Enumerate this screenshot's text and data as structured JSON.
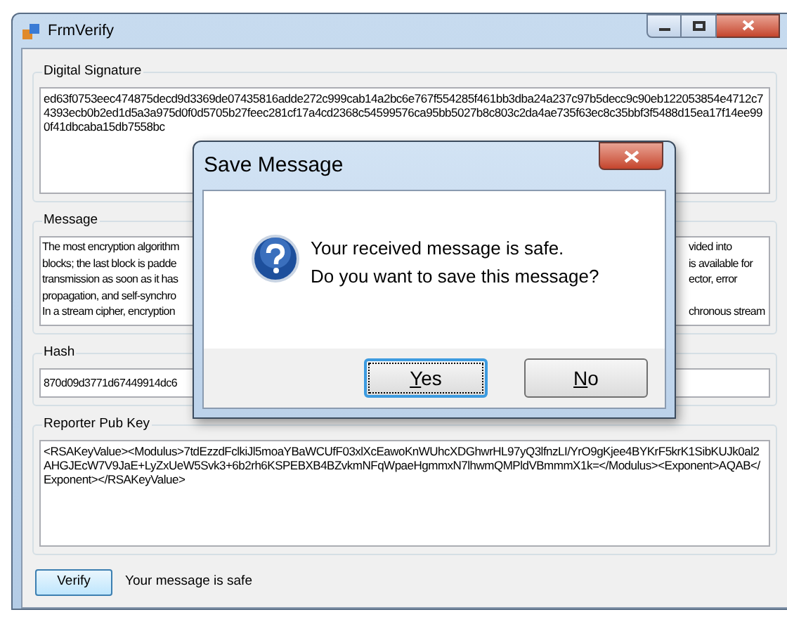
{
  "window": {
    "title": "FrmVerify"
  },
  "groups": [
    {
      "kind": "text",
      "label": "Digital Signature",
      "value": "ed63f0753eec474875decd9d3369de07435816adde272c999cab14a2bc6e767f554285f461bb3dba24a237c97b5decc9c90eb122053854e4712c74393ecb0b2ed1d5a3a975d0f0d5705b27feec281cf17a4cd2368c54599576ca95bb5027b8c803c2da4ae735f63ec8c35bbf3f5488d15ea17f14ee990f41dbcaba15db7558bc"
    },
    {
      "kind": "split",
      "label": "Message",
      "lines": [
        {
          "left": "The most encryption algorithm",
          "right": "vided into"
        },
        {
          "left": "blocks; the last block is padde",
          "right": "is available for"
        },
        {
          "left": "transmission as soon as it has",
          "right": "ector, error"
        },
        {
          "left": "propagation, and self-synchro"
        },
        {
          "left": "In a stream cipher, encryption",
          "right": "chronous stream"
        }
      ]
    },
    {
      "kind": "line",
      "label": "Hash",
      "value": "870d09d3771d67449914dc6"
    },
    {
      "kind": "text",
      "label": "Reporter Pub Key",
      "value": "<RSAKeyValue><Modulus>7tdEzzdFclkiJl5moaYBaWCUfF03xlXcEawoKnWUhcXDGhwrHL97yQ3lfnzLI/YrO9gKjee4BYKrF5krK1SibKUJk0al2AHGJEcW7V9JaE+LyZxUeW5Svk3+6b2rh6KSPEBXB4BZvkmNFqWpaeHgmmxN7lhwmQMPldVBmmmX1k=</Modulus><Exponent>AQAB</Exponent></RSAKeyValue>"
    }
  ],
  "verify_button": "Verify",
  "status": "Your message is safe",
  "dialog": {
    "title": "Save Message",
    "lines": [
      "Your received message is safe.",
      "Do you want to save this message?"
    ],
    "buttons": [
      {
        "label": "Yes",
        "focused": true
      },
      {
        "label": "No",
        "focused": false
      }
    ]
  }
}
